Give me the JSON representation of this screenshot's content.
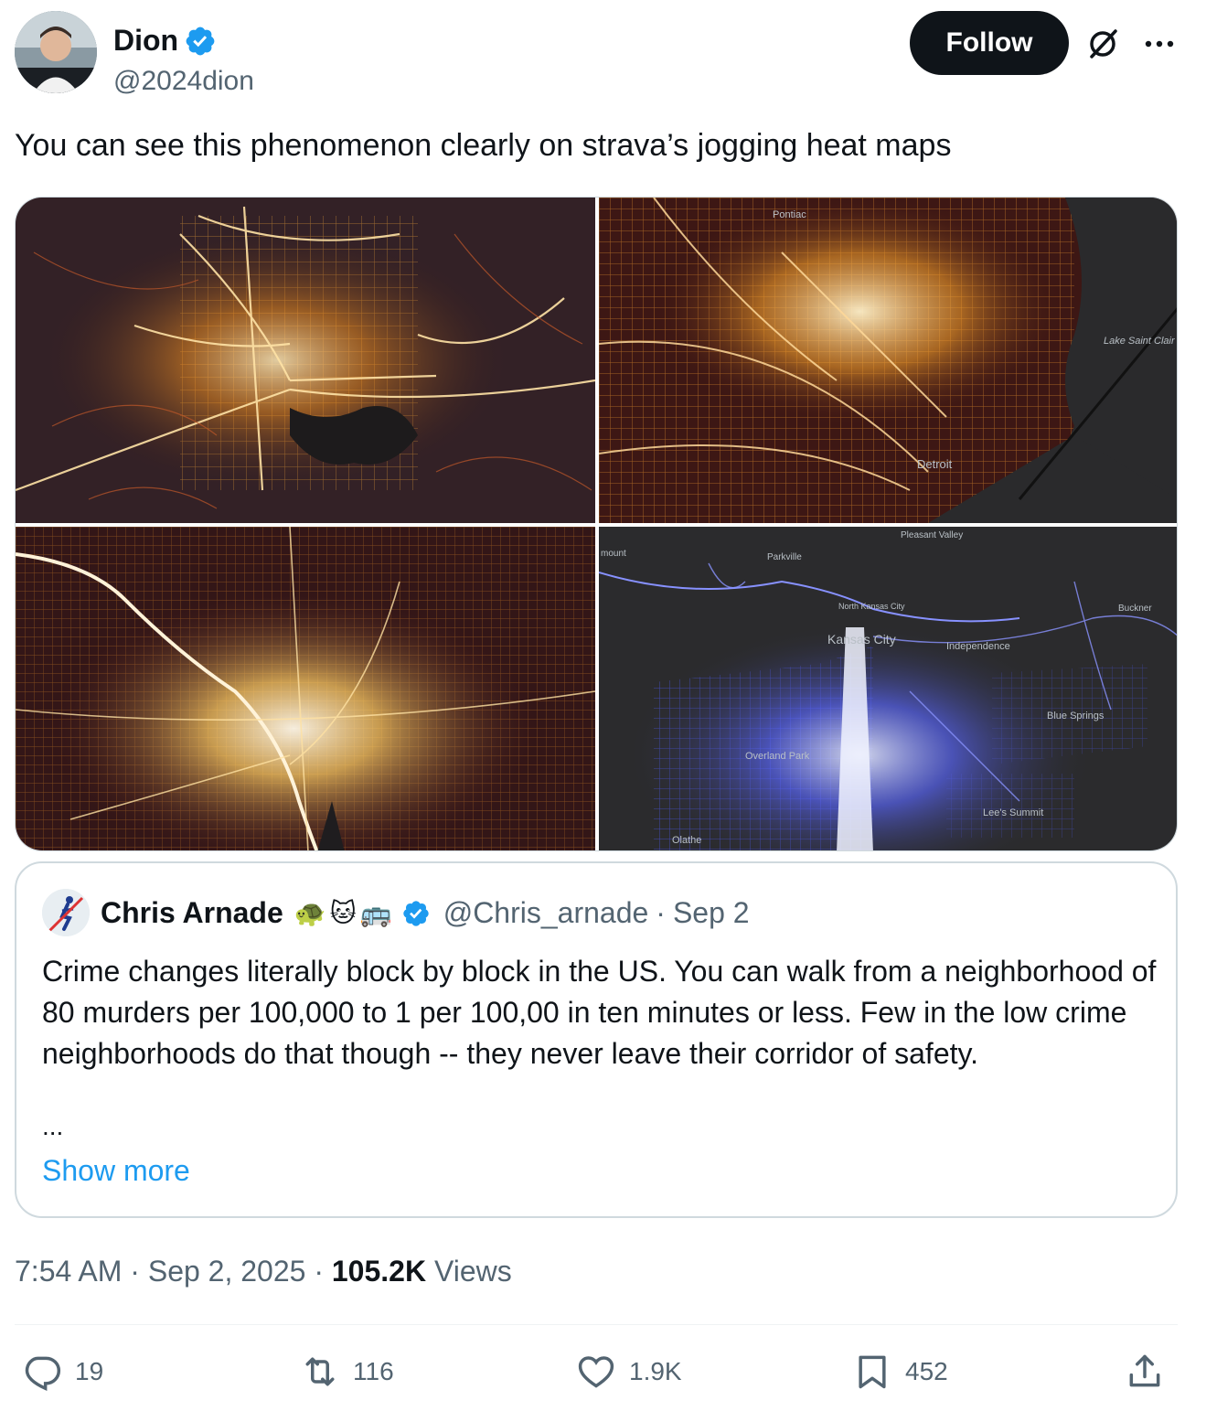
{
  "author": {
    "name": "Dion",
    "handle": "@2024dion",
    "verified": true,
    "follow_label": "Follow"
  },
  "tweet": {
    "text": "You can see this phenomenon clearly on strava’s jogging heat maps"
  },
  "media": {
    "tiles": [
      {
        "theme": "heat-orange",
        "labels": []
      },
      {
        "theme": "heat-orange",
        "labels": [
          "Pontiac",
          "Lake Saint Clair",
          "Detroit"
        ]
      },
      {
        "theme": "heat-orange",
        "labels": []
      },
      {
        "theme": "heat-blue",
        "labels": [
          "mount",
          "Pleasant Valley",
          "Parkville",
          "North Kansas City",
          "Kansas City",
          "Independence",
          "Buckner",
          "Blue Springs",
          "Overland Park",
          "Lee's Summit",
          "Olathe"
        ]
      }
    ]
  },
  "quote": {
    "name": "Chris Arnade",
    "emojis": [
      "🐢",
      "🐱",
      "🚌"
    ],
    "handle": "@Chris_arnade",
    "date": "Sep 2",
    "body": "Crime changes literally block by block in the US. You can walk from a neighborhood of 80 murders per 100,000  to 1 per 100,00 in ten minutes or less. Few in the low crime neighborhoods do that though -- they never leave their corridor of safety.",
    "ellipsis": "...",
    "show_more": "Show more"
  },
  "meta": {
    "time": "7:54 AM",
    "date": "Sep 2, 2025",
    "views_count": "105.2K",
    "views_label": "Views"
  },
  "actions": {
    "replies": "19",
    "reposts": "116",
    "likes": "1.9K",
    "bookmarks": "452"
  },
  "colors": {
    "accent": "#1d9bf0",
    "text": "#0f1419",
    "secondary": "#536471",
    "border": "#cfd9de",
    "map_bg": "#2a2a2a",
    "heat_orange": "#f7b33b",
    "heat_blue": "#4a55e6"
  }
}
